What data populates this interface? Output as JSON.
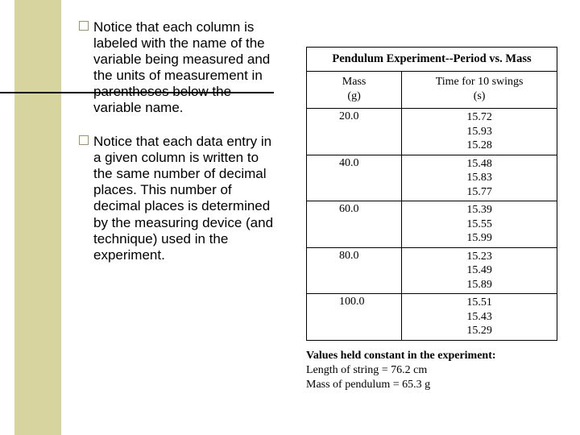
{
  "left": {
    "para1": "Notice that each column is labeled with the name of the variable being measured and the units of measurement in parentheses below the variable name.",
    "para2": "Notice that each data entry in a given column is written to the same number of decimal places. This number of decimal places is determined by the measuring device (and technique) used in the experiment."
  },
  "table": {
    "title": "Pendulum Experiment--Period vs. Mass",
    "col1_name": "Mass",
    "col1_unit": "(g)",
    "col2_name": "Time for 10 swings",
    "col2_unit": "(s)",
    "rows": [
      {
        "mass": "20.0",
        "t1": "15.72",
        "t2": "15.93",
        "t3": "15.28"
      },
      {
        "mass": "40.0",
        "t1": "15.48",
        "t2": "15.83",
        "t3": "15.77"
      },
      {
        "mass": "60.0",
        "t1": "15.39",
        "t2": "15.55",
        "t3": "15.99"
      },
      {
        "mass": "80.0",
        "t1": "15.23",
        "t2": "15.49",
        "t3": "15.89"
      },
      {
        "mass": "100.0",
        "t1": "15.51",
        "t2": "15.43",
        "t3": "15.29"
      }
    ]
  },
  "constants": {
    "caption": "Values held constant in the experiment:",
    "line1": "Length of string = 76.2 cm",
    "line2": "Mass of pendulum = 65.3 g"
  }
}
